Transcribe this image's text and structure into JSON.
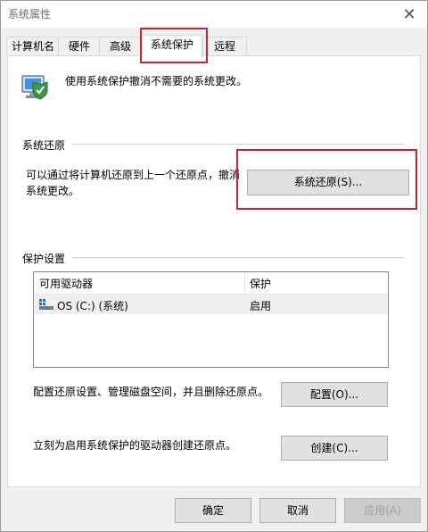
{
  "window": {
    "title": "系统属性",
    "close_glyph": "✕"
  },
  "tabs": [
    {
      "label": "计算机名"
    },
    {
      "label": "硬件"
    },
    {
      "label": "高级"
    },
    {
      "label": "系统保护"
    },
    {
      "label": "远程"
    }
  ],
  "active_tab": "系统保护",
  "intro": "使用系统保护撤消不需要的系统更改。",
  "restore": {
    "section_label": "系统还原",
    "description": "可以通过将计算机还原到上一个还原点，撤消系统更改。",
    "button_label": "系统还原(S)..."
  },
  "protection": {
    "section_label": "保护设置",
    "columns": [
      "可用驱动器",
      "保护"
    ],
    "rows": [
      {
        "drive": "OS (C:) (系统)",
        "status": "启用"
      }
    ],
    "configure_text": "配置还原设置、管理磁盘空间，并且删除还原点。",
    "configure_button": "配置(O)...",
    "create_text": "立刻为启用系统保护的驱动器创建还原点。",
    "create_button": "创建(C)..."
  },
  "footer": {
    "ok": "确定",
    "cancel": "取消",
    "apply": "应用(A)"
  },
  "colors": {
    "highlight_border": "#c3282c",
    "button_face": "#e1e1e1",
    "disabled_text": "#a0a0a0"
  },
  "icons": [
    "shield-computer-icon",
    "drive-icon",
    "close-icon"
  ]
}
